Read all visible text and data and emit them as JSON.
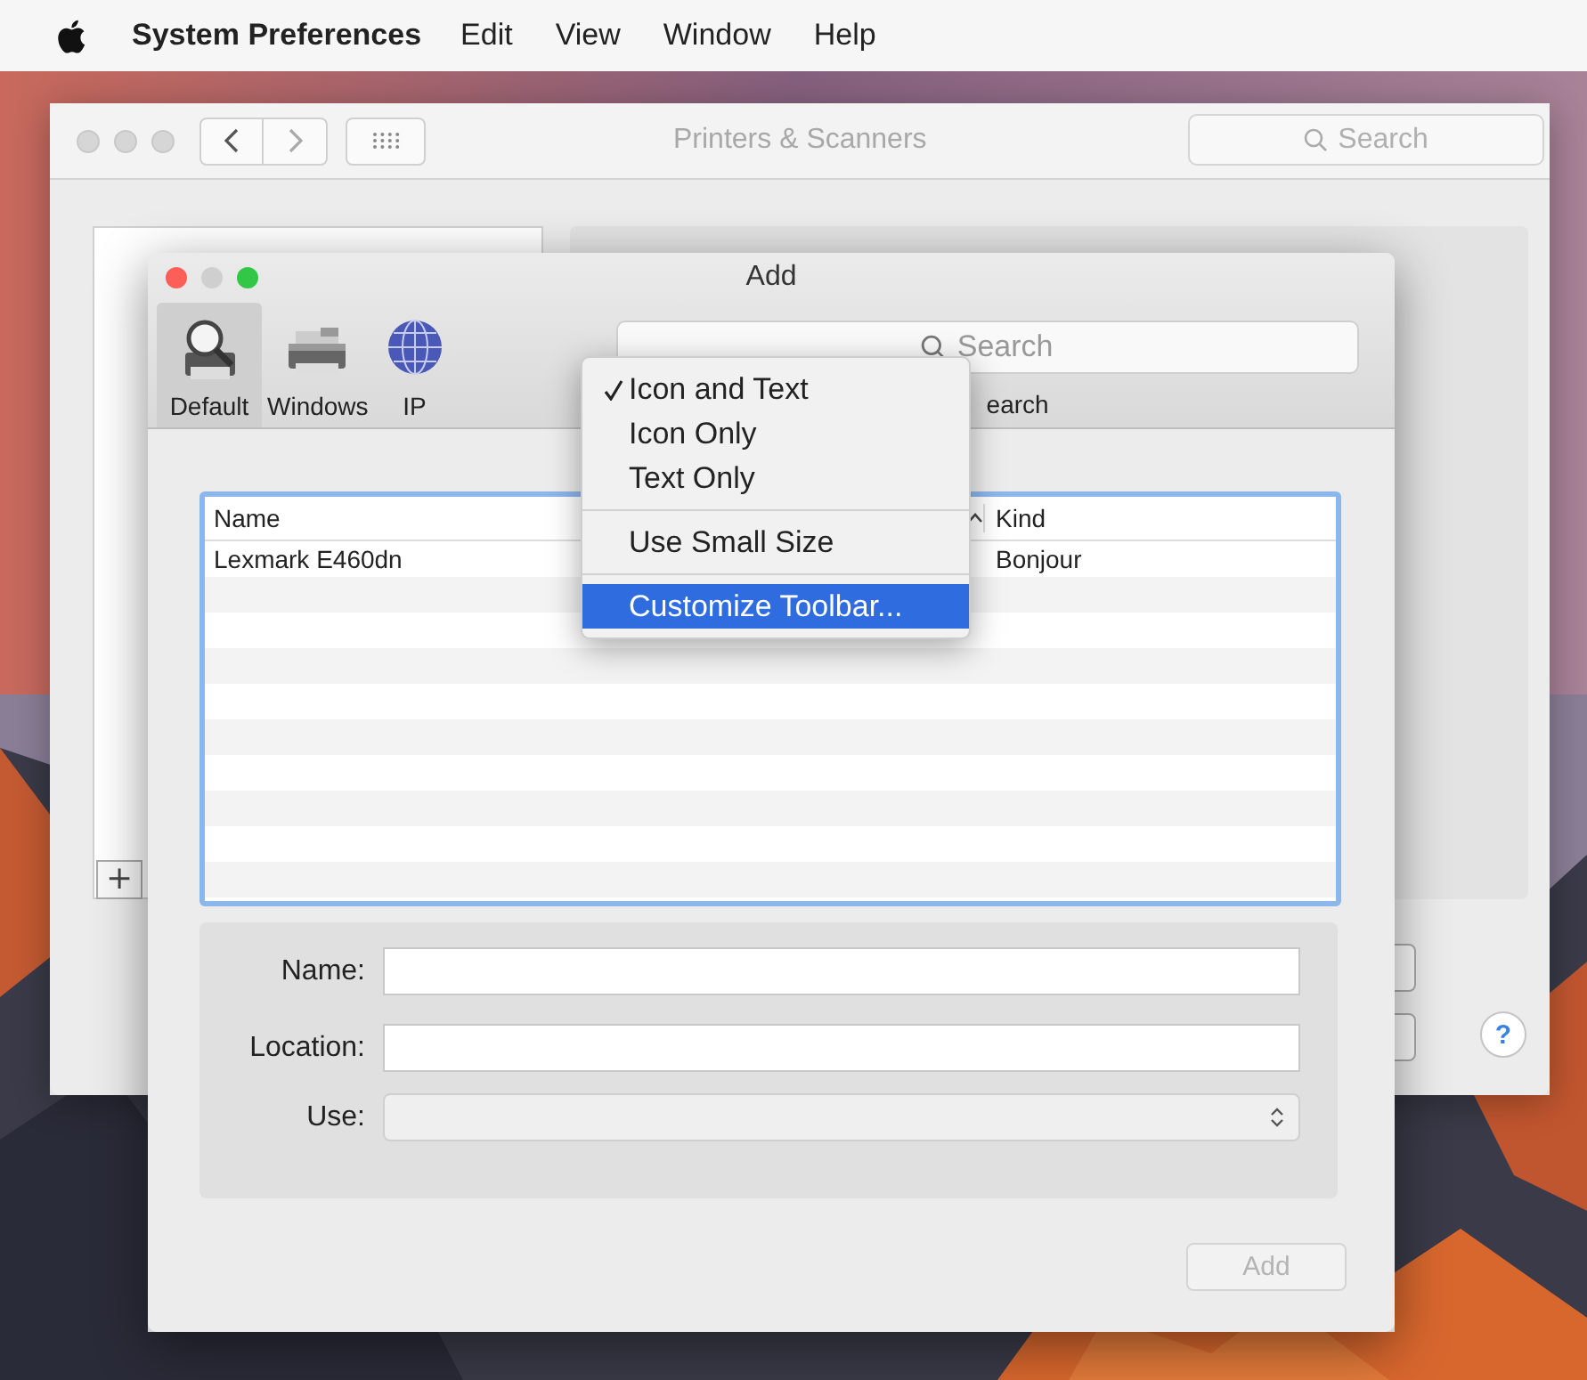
{
  "menubar": {
    "app_name": "System Preferences",
    "menus": [
      "Edit",
      "View",
      "Window",
      "Help"
    ]
  },
  "back_window": {
    "title": "Printers & Scanners",
    "search": {
      "placeholder": "Search"
    },
    "add_button": "+",
    "help_button": "?"
  },
  "add_dialog": {
    "title": "Add",
    "toolbar": [
      {
        "label": "Default",
        "selected": true,
        "kind": "search-printer"
      },
      {
        "label": "Windows",
        "selected": false,
        "kind": "printer"
      },
      {
        "label": "IP",
        "selected": false,
        "kind": "globe"
      }
    ],
    "search": {
      "placeholder": "Search",
      "label": "earch"
    },
    "table": {
      "columns": [
        "Name",
        "Kind"
      ],
      "rows": [
        {
          "name": "Lexmark E460dn",
          "kind": "Bonjour"
        }
      ]
    },
    "form": {
      "fields": [
        {
          "label": "Name:",
          "kind": "text"
        },
        {
          "label": "Location:",
          "kind": "text"
        },
        {
          "label": "Use:",
          "kind": "popup"
        }
      ]
    },
    "add_button": {
      "label": "Add",
      "disabled": true
    }
  },
  "context_menu": {
    "items": [
      {
        "kind": "item",
        "label": "Icon and Text",
        "checked": true,
        "selected": false
      },
      {
        "kind": "item",
        "label": "Icon Only",
        "checked": false,
        "selected": false
      },
      {
        "kind": "item",
        "label": "Text Only",
        "checked": false,
        "selected": false
      },
      {
        "kind": "separator"
      },
      {
        "kind": "item",
        "label": "Use Small Size",
        "checked": false,
        "selected": false
      },
      {
        "kind": "separator"
      },
      {
        "kind": "item",
        "label": "Customize Toolbar...",
        "checked": false,
        "selected": true
      }
    ]
  }
}
